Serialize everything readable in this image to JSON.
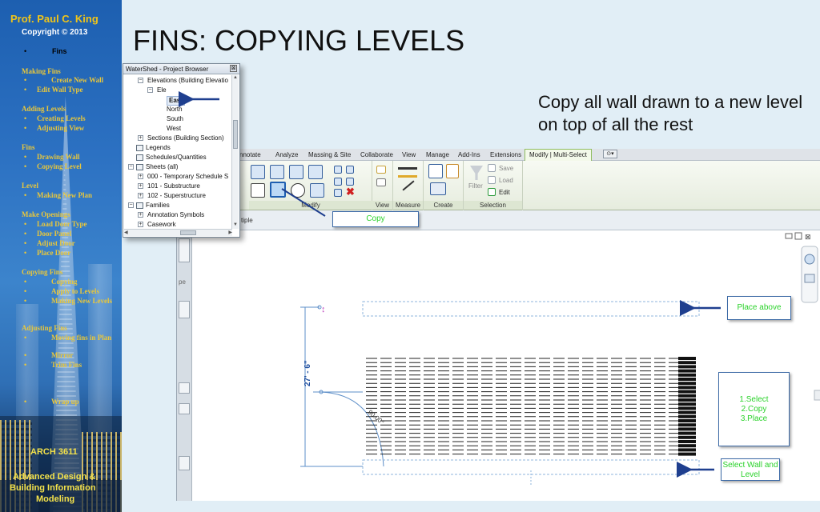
{
  "slide": {
    "title": "FINS: COPYING LEVELS",
    "description": "Copy all wall drawn to a new level on top of all the rest"
  },
  "sidebar": {
    "author": "Prof. Paul C. King",
    "copyright": "Copyright © 2013",
    "current": "Fins",
    "sections": [
      {
        "title": "Making Fins",
        "items": [
          "Create New Wall",
          "Edit Wall Type"
        ]
      },
      {
        "title": "Adding Levels",
        "items": [
          "Creating Levels",
          "Adjusting View"
        ]
      },
      {
        "title": "Fins",
        "items": [
          "Drawing Wall",
          "Copying Level"
        ]
      },
      {
        "title": "Level",
        "items": [
          "Making New Plan"
        ]
      },
      {
        "title": "Make Openings",
        "items": [
          "Load Door Type",
          "Door Panel",
          "Adjust Door",
          "Place Door"
        ]
      },
      {
        "title": "Copying Fins",
        "items": [
          "Copying",
          "Apply to Levels",
          "Making New Levels"
        ]
      },
      {
        "title": "Adjusting Fins",
        "items": [
          "Moving fins in Plan",
          "Mirror",
          "Trim Fins"
        ]
      },
      {
        "title": "",
        "items": [
          "Wrap up"
        ]
      }
    ],
    "course": "ARCH 3611",
    "course_name_line1": "Advanced Design &",
    "course_name_line2": "Building Information",
    "course_name_line3": "Modeling"
  },
  "revit": {
    "menu_tabs": [
      "nnotate",
      "Analyze",
      "Massing & Site",
      "Collaborate",
      "View",
      "Manage",
      "Add-Ins",
      "Extensions",
      "Modify | Multi-Select"
    ],
    "ribbon_groups": [
      "Modify",
      "View",
      "Measure",
      "Create",
      "Selection"
    ],
    "ribbon_buttons": {
      "save": "Save",
      "load": "Load",
      "edit": "Edit",
      "filter": "Filter"
    },
    "options_bar_text": "tiple",
    "left_strip_labels": [
      "pe"
    ],
    "dimension": "27' - 6\"",
    "door_tag": "90.00°"
  },
  "browser": {
    "title": "WaterShed - Project Browser",
    "tree": [
      {
        "label": "Elevations (Building Elevatio",
        "depth": 1,
        "toggle": "-"
      },
      {
        "label": "Ele",
        "depth": 2,
        "toggle": "-"
      },
      {
        "label": "East",
        "depth": 3,
        "selected": true
      },
      {
        "label": "North",
        "depth": 3
      },
      {
        "label": "South",
        "depth": 3
      },
      {
        "label": "West",
        "depth": 3
      },
      {
        "label": "Sections (Building Section)",
        "depth": 1,
        "toggle": "+"
      },
      {
        "label": "Legends",
        "depth": 0
      },
      {
        "label": "Schedules/Quantities",
        "depth": 0
      },
      {
        "label": "Sheets (all)",
        "depth": 0,
        "toggle": "-"
      },
      {
        "label": "000 - Temporary Schedule S",
        "depth": 1,
        "toggle": "+"
      },
      {
        "label": "101 - Substructure",
        "depth": 1,
        "toggle": "+"
      },
      {
        "label": "102 - Superstructure",
        "depth": 1,
        "toggle": "+"
      },
      {
        "label": "Families",
        "depth": 0,
        "toggle": "-"
      },
      {
        "label": "Annotation Symbols",
        "depth": 1,
        "toggle": "+"
      },
      {
        "label": "Casework",
        "depth": 1,
        "toggle": "+"
      }
    ]
  },
  "callouts": {
    "copy": "Copy",
    "place_above": "Place above",
    "steps": [
      "1.Select",
      "2.Copy",
      "3.Place"
    ],
    "select_wall_line1": "Select Wall and",
    "select_wall_line2": "Level"
  },
  "colors": {
    "accent_green": "#2bd22b",
    "sidebar_gold": "#e9c73b",
    "arrow_blue": "#1f3f8f"
  }
}
